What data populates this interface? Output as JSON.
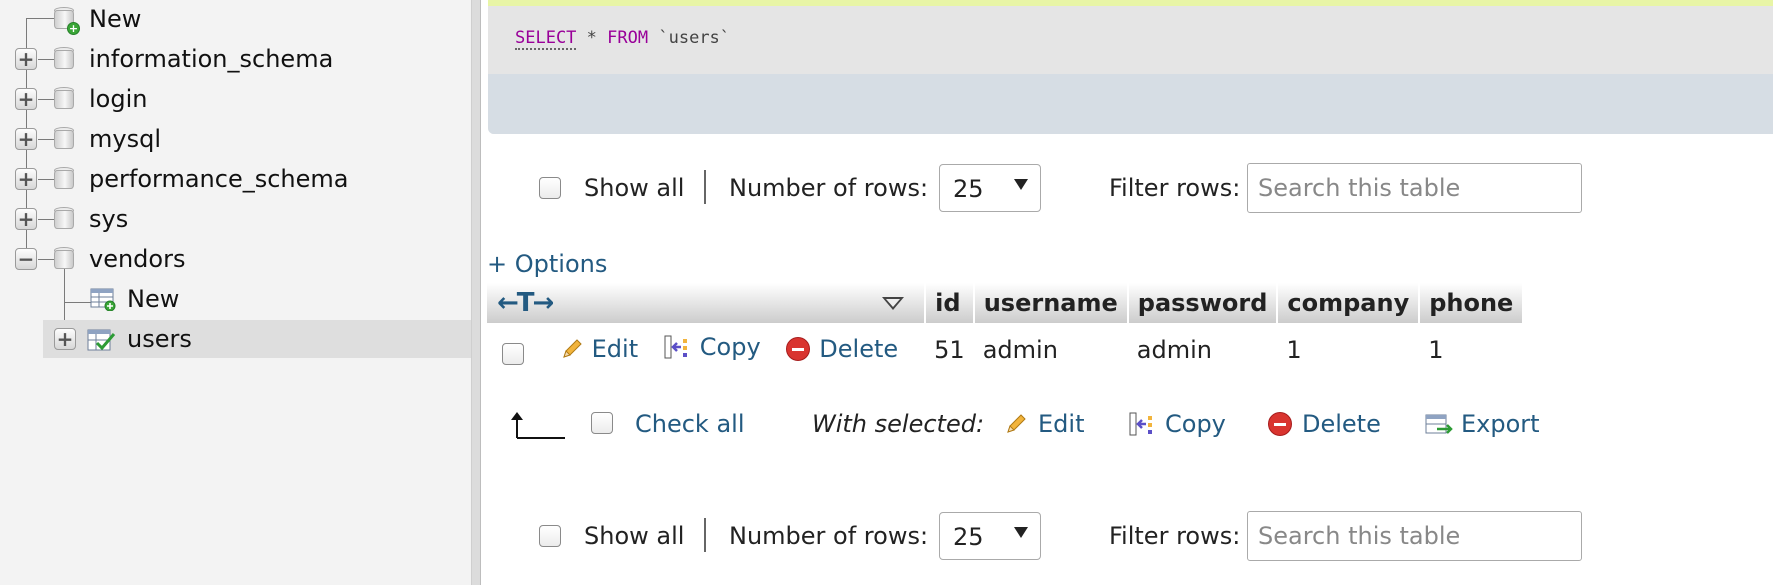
{
  "sidebar": {
    "items": [
      {
        "label": "New",
        "type": "new-db"
      },
      {
        "label": "information_schema",
        "type": "db"
      },
      {
        "label": "login",
        "type": "db"
      },
      {
        "label": "mysql",
        "type": "db"
      },
      {
        "label": "performance_schema",
        "type": "db"
      },
      {
        "label": "sys",
        "type": "db"
      },
      {
        "label": "vendors",
        "type": "db-expanded"
      },
      {
        "label": "New",
        "type": "new-table"
      },
      {
        "label": "users",
        "type": "table-selected"
      }
    ]
  },
  "query": {
    "keyword_select": "SELECT",
    "star": "*",
    "keyword_from": "FROM",
    "table_ident": "`users`"
  },
  "nav_top": {
    "show_all": "Show all",
    "rows_label": "Number of rows:",
    "rows_value": "25",
    "filter_label": "Filter rows:",
    "search_placeholder": "Search this table"
  },
  "nav_bottom": {
    "show_all": "Show all",
    "rows_label": "Number of rows:",
    "rows_value": "25",
    "filter_label": "Filter rows:",
    "search_placeholder": "Search this table"
  },
  "options_link": "+ Options",
  "table": {
    "sort_arrows": "←T→",
    "columns": [
      "id",
      "username",
      "password",
      "company",
      "phone"
    ],
    "rows": [
      {
        "actions": {
          "edit": "Edit",
          "copy": "Copy",
          "delete": "Delete"
        },
        "cells": [
          "51",
          "admin",
          "admin",
          "1",
          "1"
        ]
      }
    ]
  },
  "bulk": {
    "check_all": "Check all",
    "with_selected": "With selected:",
    "edit": "Edit",
    "copy": "Copy",
    "delete": "Delete",
    "export": "Export"
  },
  "colors": {
    "link": "#235a81",
    "sql_keyword": "#990099",
    "delete_red": "#d9342f",
    "add_green": "#3aa637"
  }
}
